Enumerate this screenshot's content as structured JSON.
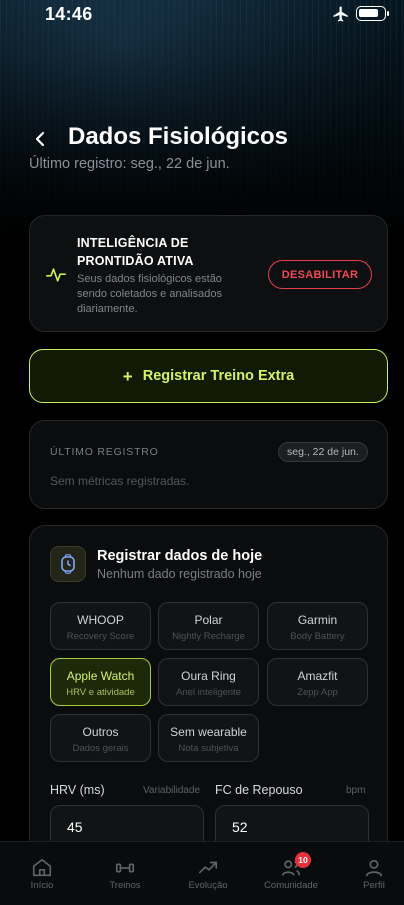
{
  "status_bar": {
    "time": "14:46"
  },
  "header": {
    "title": "Dados Fisiológicos",
    "subtitle": "Último registro: seg., 22 de jun."
  },
  "ai_card": {
    "title": "INTELIGÊNCIA DE PRONTIDÃO ATIVA",
    "description": "Seus dados fisiológicos estão sendo coletados e analisados diariamente.",
    "disable_label": "DESABILITAR"
  },
  "extra_workout": {
    "label": "Registrar Treino Extra"
  },
  "last_record": {
    "label": "ÚLTIMO REGISTRO",
    "date": "seg., 22 de jun.",
    "empty_text": "Sem métricas registradas."
  },
  "register_today": {
    "title": "Registrar dados de hoje",
    "subtitle": "Nenhum dado registrado hoje",
    "devices": [
      {
        "name": "WHOOP",
        "sub": "Recovery Score",
        "selected": false
      },
      {
        "name": "Polar",
        "sub": "Nightly Recharge",
        "selected": false
      },
      {
        "name": "Garmin",
        "sub": "Body Battery",
        "selected": false
      },
      {
        "name": "Apple Watch",
        "sub": "HRV e atividade",
        "selected": true
      },
      {
        "name": "Oura Ring",
        "sub": "Anel inteligente",
        "selected": false
      },
      {
        "name": "Amazfit",
        "sub": "Zepp App",
        "selected": false
      },
      {
        "name": "Outros",
        "sub": "Dados gerais",
        "selected": false
      },
      {
        "name": "Sem wearable",
        "sub": "Nota subjetiva",
        "selected": false
      }
    ],
    "hrv": {
      "label": "HRV (ms)",
      "hint": "Variabilidade",
      "value": "45"
    },
    "rhr": {
      "label": "FC de Repouso",
      "hint": "bpm",
      "value": "52"
    }
  },
  "bottom_nav": {
    "items": [
      {
        "label": "Início",
        "icon": "home-icon"
      },
      {
        "label": "Treinos",
        "icon": "dumbbell-icon"
      },
      {
        "label": "Evolução",
        "icon": "trending-up-icon"
      },
      {
        "label": "Comunidade",
        "icon": "users-icon",
        "badge": "10"
      },
      {
        "label": "Perfil",
        "icon": "user-icon"
      }
    ]
  },
  "colors": {
    "accent": "#c9ef5c",
    "danger": "#e0404a",
    "badge": "#e4313a",
    "background": "#000000"
  }
}
